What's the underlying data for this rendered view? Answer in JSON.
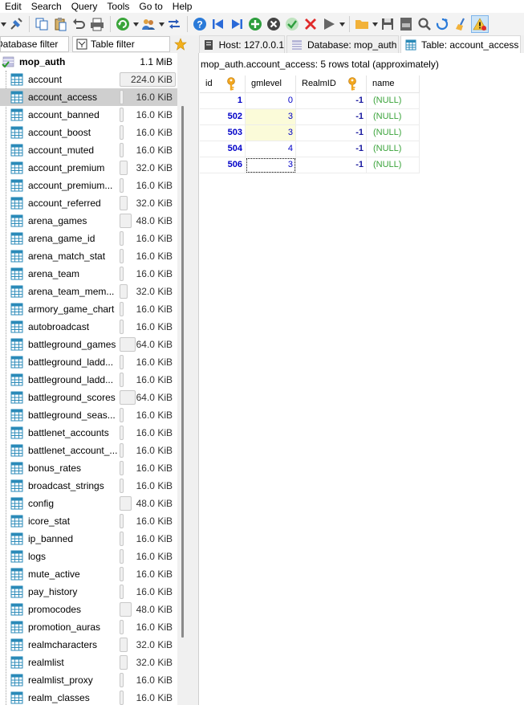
{
  "menu": [
    "Edit",
    "Search",
    "Query",
    "Tools",
    "Go to",
    "Help"
  ],
  "toolbar": {
    "buttons": [
      "dropdown-arrow",
      "connect-icon",
      "sep",
      "copy-icon",
      "paste-icon",
      "undo-icon",
      "print-icon",
      "sep",
      "refresh-icon",
      "dropdown-arrow",
      "user-manager-icon",
      "dropdown-arrow",
      "sync-icon",
      "sep",
      "help-icon",
      "first-icon",
      "last-icon",
      "add-row-icon",
      "remove-row-icon",
      "apply-icon",
      "cancel-icon",
      "run-icon",
      "dropdown-arrow",
      "sep",
      "open-folder-icon",
      "dropdown-arrow",
      "save-icon",
      "export-csv-icon",
      "search-icon",
      "find-replace-icon",
      "clean-icon",
      "warning-icon"
    ]
  },
  "filters": {
    "database_filter": "Database filter",
    "table_filter": "Table filter"
  },
  "tabs": [
    {
      "label": "Host: 127.0.0.1",
      "icon": "host-icon"
    },
    {
      "label": "Database: mop_auth",
      "icon": "database-icon"
    },
    {
      "label": "Table: account_access",
      "icon": "table-icon",
      "active": true
    }
  ],
  "tree": {
    "root": {
      "label": "mop_auth",
      "size": "1.1 MiB"
    },
    "selected": "account_access",
    "tables": [
      {
        "name": "account",
        "size": "224.0 KiB",
        "fill": 1.0
      },
      {
        "name": "account_access",
        "size": "16.0 KiB",
        "fill": 0.07
      },
      {
        "name": "account_banned",
        "size": "16.0 KiB",
        "fill": 0.07
      },
      {
        "name": "account_boost",
        "size": "16.0 KiB",
        "fill": 0.07
      },
      {
        "name": "account_muted",
        "size": "16.0 KiB",
        "fill": 0.07
      },
      {
        "name": "account_premium",
        "size": "32.0 KiB",
        "fill": 0.14
      },
      {
        "name": "account_premium...",
        "size": "16.0 KiB",
        "fill": 0.07
      },
      {
        "name": "account_referred",
        "size": "32.0 KiB",
        "fill": 0.14
      },
      {
        "name": "arena_games",
        "size": "48.0 KiB",
        "fill": 0.21
      },
      {
        "name": "arena_game_id",
        "size": "16.0 KiB",
        "fill": 0.07
      },
      {
        "name": "arena_match_stat",
        "size": "16.0 KiB",
        "fill": 0.07
      },
      {
        "name": "arena_team",
        "size": "16.0 KiB",
        "fill": 0.07
      },
      {
        "name": "arena_team_mem...",
        "size": "32.0 KiB",
        "fill": 0.14
      },
      {
        "name": "armory_game_chart",
        "size": "16.0 KiB",
        "fill": 0.07
      },
      {
        "name": "autobroadcast",
        "size": "16.0 KiB",
        "fill": 0.07
      },
      {
        "name": "battleground_games",
        "size": "64.0 KiB",
        "fill": 0.29
      },
      {
        "name": "battleground_ladd...",
        "size": "16.0 KiB",
        "fill": 0.07
      },
      {
        "name": "battleground_ladd...",
        "size": "16.0 KiB",
        "fill": 0.07
      },
      {
        "name": "battleground_scores",
        "size": "64.0 KiB",
        "fill": 0.29
      },
      {
        "name": "battleground_seas...",
        "size": "16.0 KiB",
        "fill": 0.07
      },
      {
        "name": "battlenet_accounts",
        "size": "16.0 KiB",
        "fill": 0.07
      },
      {
        "name": "battlenet_account_...",
        "size": "16.0 KiB",
        "fill": 0.07
      },
      {
        "name": "bonus_rates",
        "size": "16.0 KiB",
        "fill": 0.07
      },
      {
        "name": "broadcast_strings",
        "size": "16.0 KiB",
        "fill": 0.07
      },
      {
        "name": "config",
        "size": "48.0 KiB",
        "fill": 0.21
      },
      {
        "name": "icore_stat",
        "size": "16.0 KiB",
        "fill": 0.07
      },
      {
        "name": "ip_banned",
        "size": "16.0 KiB",
        "fill": 0.07
      },
      {
        "name": "logs",
        "size": "16.0 KiB",
        "fill": 0.07
      },
      {
        "name": "mute_active",
        "size": "16.0 KiB",
        "fill": 0.07
      },
      {
        "name": "pay_history",
        "size": "16.0 KiB",
        "fill": 0.07
      },
      {
        "name": "promocodes",
        "size": "48.0 KiB",
        "fill": 0.21
      },
      {
        "name": "promotion_auras",
        "size": "16.0 KiB",
        "fill": 0.07
      },
      {
        "name": "realmcharacters",
        "size": "32.0 KiB",
        "fill": 0.14
      },
      {
        "name": "realmlist",
        "size": "32.0 KiB",
        "fill": 0.14
      },
      {
        "name": "realmlist_proxy",
        "size": "16.0 KiB",
        "fill": 0.07
      },
      {
        "name": "realm_classes",
        "size": "16.0 KiB",
        "fill": 0.07
      }
    ]
  },
  "grid": {
    "caption": "mop_auth.account_access: 5 rows total (approximately)",
    "columns": [
      {
        "label": "id",
        "key": true
      },
      {
        "label": "gmlevel",
        "key": false
      },
      {
        "label": "RealmID",
        "key": true
      },
      {
        "label": "name",
        "key": false
      }
    ],
    "rows": [
      [
        "1",
        "0",
        "-1",
        "(NULL)"
      ],
      [
        "502",
        "3",
        "-1",
        "(NULL)"
      ],
      [
        "503",
        "3",
        "-1",
        "(NULL)"
      ],
      [
        "504",
        "4",
        "-1",
        "(NULL)"
      ],
      [
        "506",
        "3",
        "-1",
        "(NULL)"
      ]
    ]
  },
  "colors": {
    "selected_row": "#cfcfcf",
    "number_text": "#0000c8",
    "null_text": "#3aa33a",
    "highlight_cell": "#fbfbd9"
  }
}
